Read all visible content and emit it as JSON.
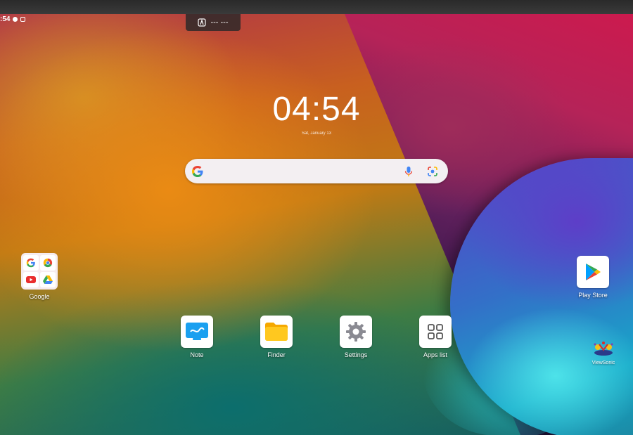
{
  "status_bar": {
    "time": ":54"
  },
  "top_pill": {
    "text": "--- ---"
  },
  "clock": {
    "time": "04:54",
    "date": "Sat, January 13"
  },
  "search": {
    "placeholder": ""
  },
  "apps": {
    "google_folder": {
      "label": "Google",
      "items": [
        "google-icon",
        "chrome-icon",
        "youtube-icon",
        "drive-icon"
      ]
    },
    "play_store": {
      "label": "Play Store"
    },
    "note": {
      "label": "Note"
    },
    "finder": {
      "label": "Finder"
    },
    "settings": {
      "label": "Settings"
    },
    "apps_list": {
      "label": "Apps list"
    },
    "viewsonic": {
      "label": "ViewSonic"
    }
  },
  "colors": {
    "search_bg": "#f3eff2",
    "google_blue": "#4285F4",
    "google_red": "#EA4335",
    "google_yellow": "#FBBC05",
    "google_green": "#34A853"
  }
}
